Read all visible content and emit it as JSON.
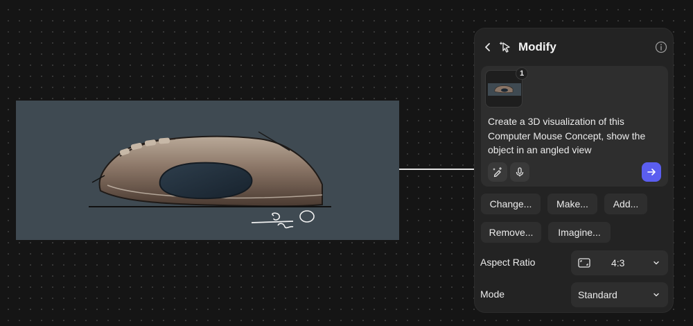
{
  "panel": {
    "title": "Modify",
    "icons": {
      "back": "chevron-left-icon",
      "modify": "cursor-sparkle-icon",
      "info": "info-icon"
    }
  },
  "prompt": {
    "attachment_count": "1",
    "text": "Create a 3D visualization of this Computer Mouse Concept, show the object in an angled view",
    "tools": [
      "magic-pen-icon",
      "microphone-icon"
    ],
    "send_icon": "arrow-right-icon"
  },
  "suggestions": [
    "Change...",
    "Make...",
    "Add...",
    "Remove...",
    "Imagine..."
  ],
  "settings": {
    "aspect_ratio": {
      "label": "Aspect Ratio",
      "value": "4:3",
      "icon": "aspect-ratio-icon"
    },
    "mode": {
      "label": "Mode",
      "value": "Standard"
    }
  },
  "colors": {
    "background": "#151515",
    "panel": "#232323",
    "field": "#2e2e2e",
    "accent": "#5b5ef0",
    "image_backdrop": "#3f4a52"
  }
}
